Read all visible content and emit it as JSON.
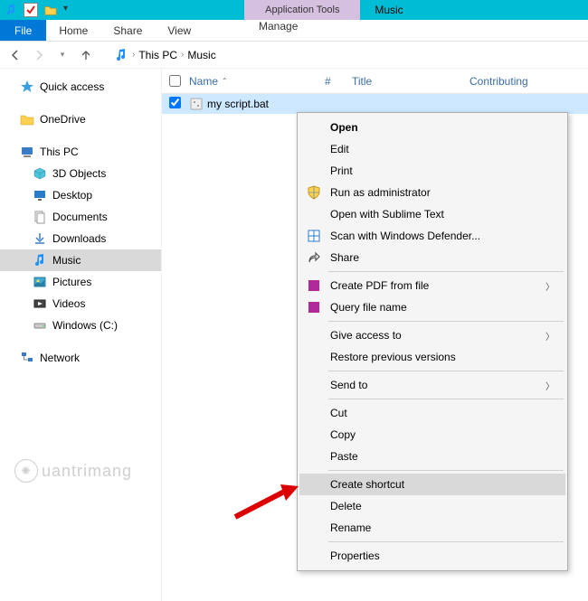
{
  "titlebar": {
    "contextual_group": "Application Tools",
    "window_title": "Music"
  },
  "ribbon": {
    "file": "File",
    "home": "Home",
    "share": "Share",
    "view": "View",
    "manage": "Manage"
  },
  "breadcrumb": {
    "thispc": "This PC",
    "music": "Music"
  },
  "columns": {
    "name": "Name",
    "num": "#",
    "title": "Title",
    "contrib": "Contributing"
  },
  "navpane": {
    "quick_access": "Quick access",
    "onedrive": "OneDrive",
    "thispc": "This PC",
    "objects3d": "3D Objects",
    "desktop": "Desktop",
    "documents": "Documents",
    "downloads": "Downloads",
    "music": "Music",
    "pictures": "Pictures",
    "videos": "Videos",
    "windowsc": "Windows (C:)",
    "network": "Network"
  },
  "files": [
    {
      "name": "my script.bat",
      "checked": true
    }
  ],
  "contextmenu": {
    "open": "Open",
    "edit": "Edit",
    "print": "Print",
    "runadmin": "Run as administrator",
    "sublime": "Open with Sublime Text",
    "defender": "Scan with Windows Defender...",
    "share": "Share",
    "createpdf": "Create PDF from file",
    "queryfile": "Query file name",
    "giveaccess": "Give access to",
    "restore": "Restore previous versions",
    "sendto": "Send to",
    "cut": "Cut",
    "copy": "Copy",
    "paste": "Paste",
    "shortcut": "Create shortcut",
    "delete": "Delete",
    "rename": "Rename",
    "properties": "Properties"
  },
  "watermark": "uantrimang"
}
